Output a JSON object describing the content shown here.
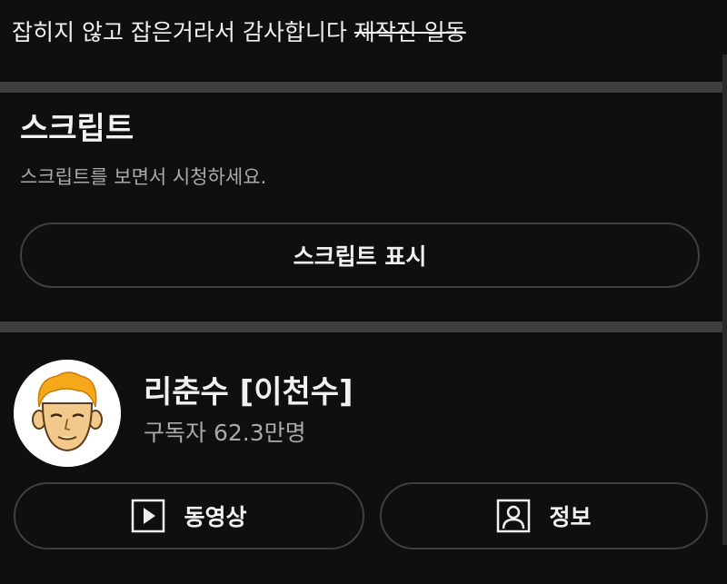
{
  "comment": {
    "text_main": "잡히지 않고 잡은거라서 감사합니다 ",
    "text_struck": "제작진 일동"
  },
  "script_panel": {
    "title": "스크립트",
    "description": "스크립트를 보면서 시청하세요.",
    "button_label": "스크립트 표시"
  },
  "channel": {
    "name": "리춘수 [이천수]",
    "subscribers": "구독자 62.3만명",
    "avatar_icon": "cartoon-face-avatar",
    "videos_label": "동영상",
    "videos_icon": "play-icon",
    "about_label": "정보",
    "about_icon": "person-icon"
  },
  "colors": {
    "background": "#0f0f0f",
    "divider": "#3f3f3f",
    "text_primary": "#f1f1f1",
    "text_secondary": "#aaaaaa",
    "button_border": "#3f3f3f"
  }
}
